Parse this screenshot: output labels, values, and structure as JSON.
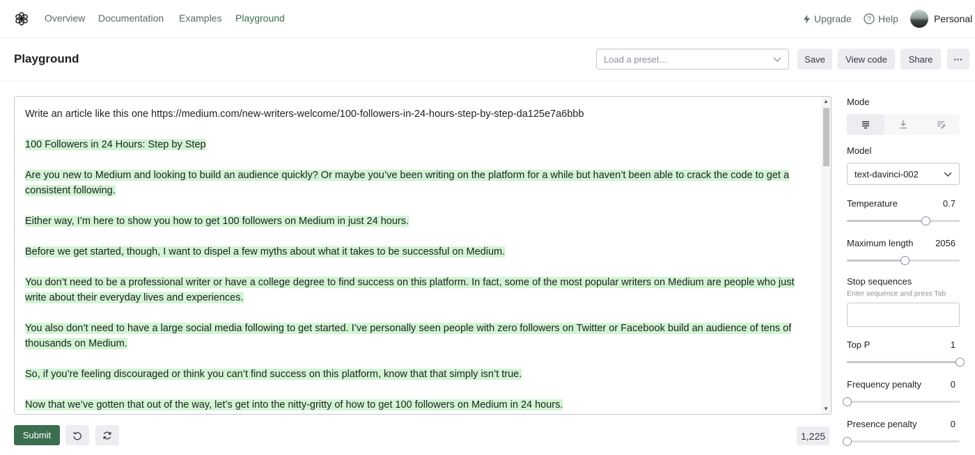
{
  "nav": {
    "links": [
      "Overview",
      "Documentation",
      "Examples",
      "Playground"
    ],
    "upgrade": "Upgrade",
    "help": "Help",
    "account": "Personal"
  },
  "header": {
    "title": "Playground",
    "preset_placeholder": "Load a preset...",
    "save": "Save",
    "view_code": "View code",
    "share": "Share",
    "more": "···"
  },
  "editor": {
    "prompt": "Write an article like this one https://medium.com/new-writers-welcome/100-followers-in-24-hours-step-by-step-da125e7a6bbb",
    "completion": [
      "100 Followers in 24 Hours: Step by Step",
      "Are you new to Medium and looking to build an audience quickly? Or maybe you’ve been writing on the platform for a while but haven’t been able to crack the code to get a consistent following.",
      "Either way, I’m here to show you how to get 100 followers on Medium in just 24 hours.",
      "Before we get started, though, I want to dispel a few myths about what it takes to be successful on Medium.",
      "You don’t need to be a professional writer or have a college degree to find success on this platform. In fact, some of the most popular writers on Medium are people who just write about their everyday lives and experiences.",
      "You also don’t need to have a large social media following to get started. I’ve personally seen people with zero followers on Twitter or Facebook build an audience of tens of thousands on Medium.",
      "So, if you’re feeling discouraged or think you can’t find success on this platform, know that that simply isn’t true.",
      "Now that we’ve gotten that out of the way, let’s get into the nitty-gritty of how to get 100 followers on Medium in 24 hours."
    ],
    "highlight_color": "#d2f4d3"
  },
  "footer": {
    "submit": "Submit",
    "token_count": "1,225"
  },
  "sidebar": {
    "mode_label": "Mode",
    "modes": [
      "complete-icon",
      "insert-icon",
      "edit-icon"
    ],
    "model_label": "Model",
    "model_value": "text-davinci-002",
    "temperature_label": "Temperature",
    "temperature_value": "0.7",
    "temperature_fraction": 0.7,
    "max_length_label": "Maximum length",
    "max_length_value": "2056",
    "max_length_fraction": 0.51,
    "stop_label": "Stop sequences",
    "stop_hint": "Enter sequence and press Tab",
    "top_p_label": "Top P",
    "top_p_value": "1",
    "top_p_fraction": 1.0,
    "freq_label": "Frequency penalty",
    "freq_value": "0",
    "freq_fraction": 0.0,
    "presence_label": "Presence penalty",
    "presence_value": "0",
    "presence_fraction": 0.0
  },
  "colors": {
    "accent": "#3b6e4e",
    "nav_text": "#5a6a63"
  }
}
